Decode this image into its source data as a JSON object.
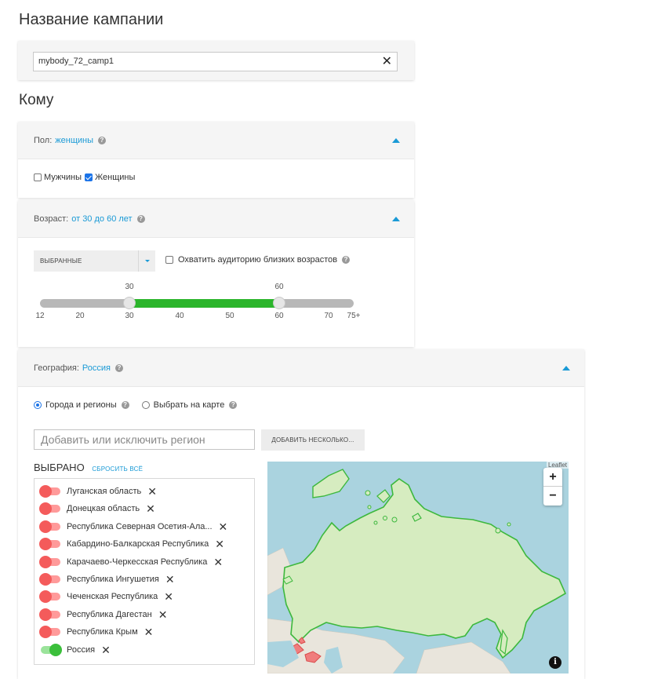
{
  "campaign": {
    "heading": "Название кампании",
    "name_value": "mybody_72_camp1",
    "clear_symbol": "✕"
  },
  "audience": {
    "heading": "Кому"
  },
  "gender": {
    "label": "Пол:",
    "value": "женщины",
    "help": "?",
    "options": [
      {
        "label": "Мужчины",
        "checked": false
      },
      {
        "label": "Женщины",
        "checked": true
      }
    ]
  },
  "age": {
    "label": "Возраст:",
    "value": "от 30 до 60 лет",
    "help": "?",
    "select_value": "ВЫБРАННЫЕ",
    "similar_label": "Охватить аудиторию близких возрастов",
    "similar_checked": false,
    "range_min": 30,
    "range_max": 60,
    "thumb_low_label": "30",
    "thumb_high_label": "60",
    "ticks": [
      "12",
      "20",
      "30",
      "40",
      "50",
      "60",
      "70",
      "75+"
    ]
  },
  "geo": {
    "label": "География:",
    "value": "Россия",
    "help": "?",
    "mode_options": [
      {
        "label": "Города и регионы",
        "selected": true
      },
      {
        "label": "Выбрать на карте",
        "selected": false
      }
    ],
    "search_placeholder": "Добавить или исключить регион",
    "add_many_label": "ДОБАВИТЬ НЕСКОЛЬКО...",
    "selected_label": "ВЫБРАНО",
    "reset_label": "СБРОСИТЬ ВСЁ",
    "selected_items": [
      {
        "label": "Луганская область",
        "included": false
      },
      {
        "label": "Донецкая область",
        "included": false
      },
      {
        "label": "Республика Северная Осетия-Ала...",
        "included": false
      },
      {
        "label": "Кабардино-Балкарская Республика",
        "included": false
      },
      {
        "label": "Карачаево-Черкесская Республика",
        "included": false
      },
      {
        "label": "Республика Ингушетия",
        "included": false
      },
      {
        "label": "Чеченская Республика",
        "included": false
      },
      {
        "label": "Республика Дагестан",
        "included": false
      },
      {
        "label": "Республика Крым",
        "included": false
      },
      {
        "label": "Россия",
        "included": true
      }
    ],
    "map": {
      "zoom_in": "+",
      "zoom_out": "−",
      "attribution": "Leaflet",
      "info": "i",
      "water_color": "#aad3df",
      "land_color": "#e9e5dc",
      "selected_color": "#d6ecc0",
      "selected_border": "#3db83d",
      "excluded_color": "#f07d7d"
    }
  },
  "colors": {
    "accent": "#1a9ad6",
    "slider_fill": "#2bb52b",
    "toggle_off": "#f45b5b",
    "toggle_on": "#3bbf3b"
  }
}
